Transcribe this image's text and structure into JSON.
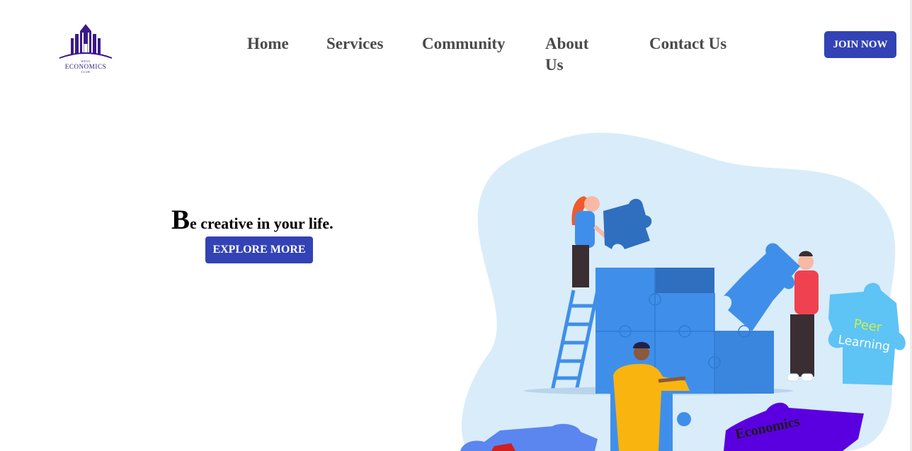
{
  "logo": {
    "top_text": "WELO",
    "main_text": "ECONOMICS",
    "bottom_text": "CLUB",
    "color": "#2a1670"
  },
  "nav": {
    "items": [
      "Home",
      "Services",
      "Community",
      "About Us",
      "Contact Us"
    ],
    "join_label": "JOIN NOW"
  },
  "hero": {
    "title_first_letter": "B",
    "title_rest": "e creative in your life.",
    "button_label": "EXPLORE MORE"
  },
  "illustration": {
    "piece_peer": "Peer",
    "piece_learning": "Learning",
    "piece_economics": "Economics"
  },
  "colors": {
    "accent": "#3342b5",
    "nav_text": "#4a4a4a",
    "blob": "#d9ecfa",
    "puzzle_blue": "#3f8fea"
  }
}
